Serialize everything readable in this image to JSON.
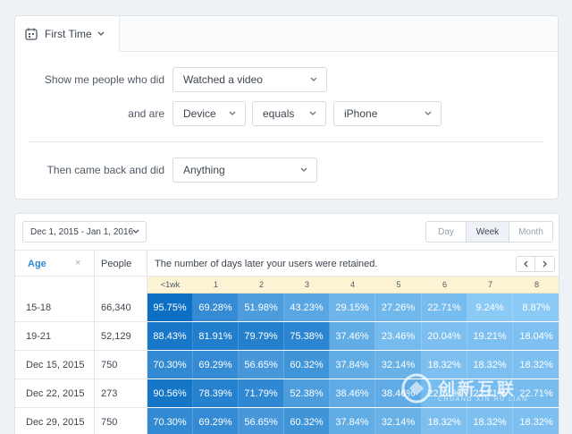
{
  "filter": {
    "tab_label": "First Time",
    "row1": {
      "label": "Show me people who did",
      "event": "Watched a video"
    },
    "row2": {
      "label": "and are",
      "property": "Device",
      "operator": "equals",
      "value": "iPhone"
    },
    "row3": {
      "label": "Then came back and did",
      "event": "Anything"
    }
  },
  "table": {
    "date_range": "Dec 1, 2015 - Jan 1, 2016",
    "granularity": [
      {
        "label": "Day",
        "active": false
      },
      {
        "label": "Week",
        "active": true
      },
      {
        "label": "Month",
        "active": false
      }
    ],
    "headers": {
      "age": "Age",
      "age_clear": "×",
      "people": "People",
      "retained": "The number of days later your users were retained."
    },
    "periods": [
      "<1wk",
      "1",
      "2",
      "3",
      "4",
      "5",
      "6",
      "7",
      "8"
    ],
    "rows": [
      {
        "age": "15-18",
        "people": "66,340",
        "values": [
          95.75,
          69.28,
          51.98,
          43.23,
          29.15,
          27.26,
          22.71,
          9.24,
          8.87
        ]
      },
      {
        "age": "19-21",
        "people": "52,129",
        "values": [
          88.43,
          81.91,
          79.79,
          75.38,
          37.46,
          23.46,
          20.04,
          19.21,
          18.04
        ]
      },
      {
        "age": "Dec 15, 2015",
        "people": "750",
        "values": [
          70.3,
          69.29,
          56.65,
          60.32,
          37.84,
          32.14,
          18.32,
          18.32,
          18.32
        ]
      },
      {
        "age": "Dec 22, 2015",
        "people": "273",
        "values": [
          90.56,
          78.39,
          71.79,
          52.38,
          38.46,
          38.46,
          22.71,
          22.71,
          22.71
        ]
      },
      {
        "age": "Dec 29, 2015",
        "people": "750",
        "values": [
          70.3,
          69.29,
          56.65,
          60.32,
          37.84,
          32.14,
          18.32,
          18.32,
          18.32
        ]
      }
    ]
  },
  "watermark": {
    "main": "创新互联",
    "sub": "CHUANG XIN HU LIAN"
  },
  "colors": {
    "accent": "#2f87d3",
    "cell_dark": "#0d6fc4",
    "cell_light": "#8ccbf6"
  },
  "icons": {
    "calendar": "calendar-icon",
    "chevron": "chevron-down-icon",
    "prev": "chevron-left-icon",
    "next": "chevron-right-icon"
  }
}
